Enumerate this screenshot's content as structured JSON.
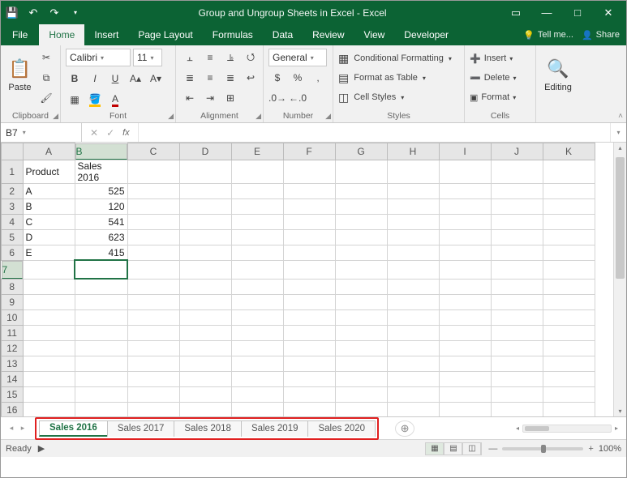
{
  "title": "Group and Ungroup Sheets in Excel - Excel",
  "tabs": {
    "file": "File",
    "home": "Home",
    "insert": "Insert",
    "pageLayout": "Page Layout",
    "formulas": "Formulas",
    "data": "Data",
    "review": "Review",
    "view": "View",
    "developer": "Developer",
    "tell": "Tell me...",
    "share": "Share"
  },
  "ribbon": {
    "clipboard": {
      "label": "Clipboard",
      "paste": "Paste"
    },
    "font": {
      "label": "Font",
      "name": "Calibri",
      "size": "11"
    },
    "alignment": {
      "label": "Alignment"
    },
    "number": {
      "label": "Number",
      "format": "General"
    },
    "styles": {
      "label": "Styles",
      "cf": "Conditional Formatting",
      "fat": "Format as Table",
      "cs": "Cell Styles"
    },
    "cells": {
      "label": "Cells",
      "insert": "Insert",
      "delete": "Delete",
      "format": "Format"
    },
    "editing": {
      "label": "Editing"
    }
  },
  "nameBox": "B7",
  "formula": "",
  "columns": [
    "A",
    "B",
    "C",
    "D",
    "E",
    "F",
    "G",
    "H",
    "I",
    "J",
    "K"
  ],
  "rows_count": 16,
  "selected": {
    "col": "B",
    "row": 7
  },
  "cells": {
    "A1": "Product",
    "B1": "Sales 2016",
    "A2": "A",
    "B2": "525",
    "A3": "B",
    "B3": "120",
    "A4": "C",
    "B4": "541",
    "A5": "D",
    "B5": "623",
    "A6": "E",
    "B6": "415"
  },
  "numeric_cells": [
    "B2",
    "B3",
    "B4",
    "B5",
    "B6"
  ],
  "sheetTabs": [
    "Sales 2016",
    "Sales 2017",
    "Sales 2018",
    "Sales 2019",
    "Sales 2020"
  ],
  "activeSheet": 0,
  "status": {
    "ready": "Ready",
    "zoom": "100%"
  },
  "chart_data": {
    "type": "table",
    "title": "Sales 2016",
    "columns": [
      "Product",
      "Sales 2016"
    ],
    "rows": [
      [
        "A",
        525
      ],
      [
        "B",
        120
      ],
      [
        "C",
        541
      ],
      [
        "D",
        623
      ],
      [
        "E",
        415
      ]
    ]
  }
}
